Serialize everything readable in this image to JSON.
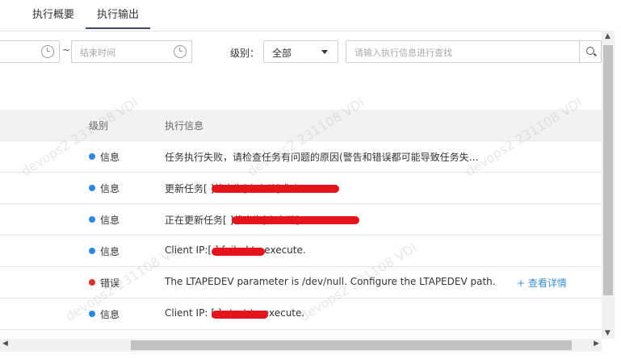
{
  "tabs": [
    {
      "label": "执行概要",
      "active": false
    },
    {
      "label": "执行输出",
      "active": true
    }
  ],
  "filters": {
    "separator": "~",
    "end_time_placeholder": "结束时间",
    "level_label": "级别：",
    "level_value": "全部",
    "search_placeholder": "请输入执行信息进行查找"
  },
  "table": {
    "headers": {
      "level": "级别",
      "info": "执行信息"
    },
    "rows": [
      {
        "level": "信息",
        "type": "info",
        "message": "任务执行失败，请检查任务有问题的原因(警告和错误都可能导致任务失…"
      },
      {
        "level": "信息",
        "type": "info",
        "message": "更新任务[                          ]状态为[未启动]成功。"
      },
      {
        "level": "信息",
        "type": "info",
        "message": "正在更新任务[                              ]状态为[未启动]。"
      },
      {
        "level": "信息",
        "type": "info",
        "message": "Client IP:[               ] failed to execute."
      },
      {
        "level": "错误",
        "type": "error",
        "message": "The LTAPEDEV parameter is /dev/null. Configure the LTAPEDEV path.",
        "detail": "+ 查看详情"
      },
      {
        "level": "信息",
        "type": "info",
        "message": "Client IP: [               ] start to execute."
      }
    ]
  },
  "watermark": "devops2 231108 VDI",
  "colors": {
    "info": "#2e86de",
    "error": "#d9302a",
    "link": "#3b8fd6",
    "redaction": "#e5141a"
  }
}
